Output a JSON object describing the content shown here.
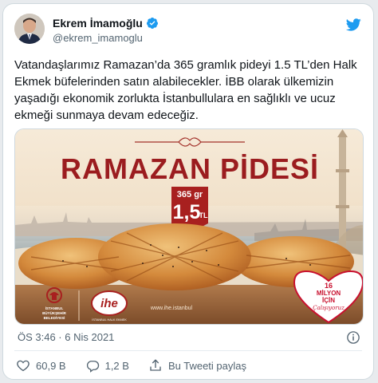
{
  "author": {
    "name": "Ekrem İmamoğlu",
    "handle": "@ekrem_imamoglu"
  },
  "tweet": {
    "text": "Vatandaşlarımız Ramazan’da 365 gramlık pideyi 1.5 TL’den Halk Ekmek büfelerinden satın alabilecekler. İBB olarak ülkemizin yaşadığı ekonomik zorlukta İstanbullulara en sağlıklı ve ucuz ekmeği sunmaya devam edeceğiz.",
    "timestamp": "ÖS 3:46 · 6 Nis 2021"
  },
  "media": {
    "headline": "RAMAZAN PİDESİ",
    "weight": "365 gr",
    "price": "1,5",
    "currency": "TL",
    "logo_ibb_line1": "İSTANBUL",
    "logo_ibb_line2": "BÜYÜKŞEHİR",
    "logo_ibb_line3": "BELEDİYESİ",
    "logo_ihe": "ihe",
    "logo_ihe_sub": "İSTANBUL HALK EKMEK",
    "url": "www.ihe.istanbul",
    "badge_line1": "16",
    "badge_line2": "MİLYON",
    "badge_line3": "İÇİN",
    "badge_line4": "Çalışıyoruz"
  },
  "actions": {
    "likes": "60,9 B",
    "replies": "1,2 B",
    "share_label": "Bu Tweeti paylaş"
  },
  "colors": {
    "accent": "#1d9bf0",
    "headline_red": "#9b1c1f",
    "banner_bg": "#f3e4cf"
  }
}
